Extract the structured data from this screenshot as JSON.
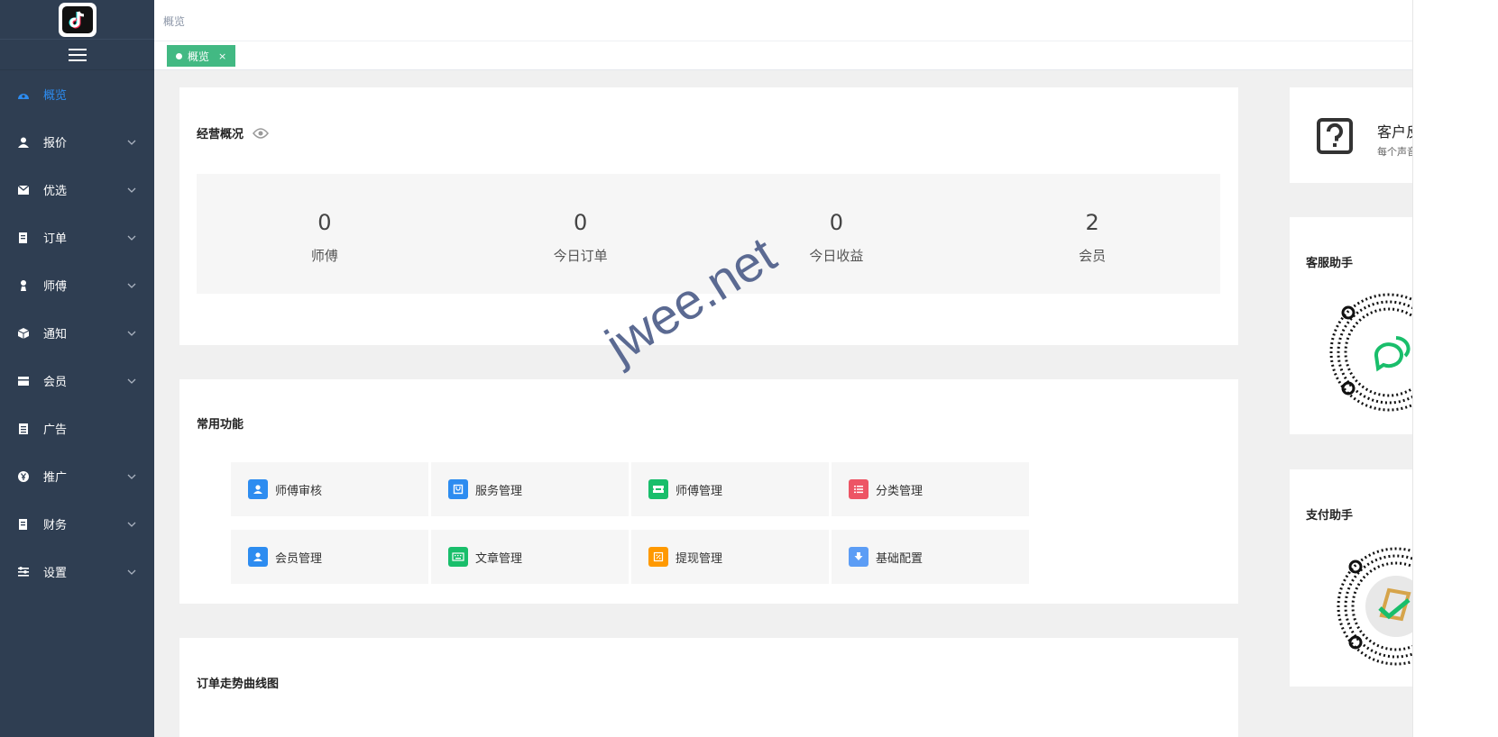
{
  "breadcrumb": "概览",
  "tab": {
    "label": "概览",
    "close": "×"
  },
  "sidebar": {
    "items": [
      {
        "label": "概览",
        "icon": "dashboard-icon",
        "active": true,
        "has_children": false
      },
      {
        "label": "报价",
        "icon": "user-tie-icon",
        "active": false,
        "has_children": true
      },
      {
        "label": "优选",
        "icon": "mail-icon",
        "active": false,
        "has_children": true
      },
      {
        "label": "订单",
        "icon": "document-icon",
        "active": false,
        "has_children": true
      },
      {
        "label": "师傅",
        "icon": "worker-icon",
        "active": false,
        "has_children": true
      },
      {
        "label": "通知",
        "icon": "cube-icon",
        "active": false,
        "has_children": true
      },
      {
        "label": "会员",
        "icon": "card-icon",
        "active": false,
        "has_children": true
      },
      {
        "label": "广告",
        "icon": "calendar-icon",
        "active": false,
        "has_children": false
      },
      {
        "label": "推广",
        "icon": "yen-icon",
        "active": false,
        "has_children": true
      },
      {
        "label": "财务",
        "icon": "finance-icon",
        "active": false,
        "has_children": true
      },
      {
        "label": "设置",
        "icon": "settings-icon",
        "active": false,
        "has_children": true
      }
    ]
  },
  "overview": {
    "title": "经营概况",
    "stats": [
      {
        "value": "0",
        "label": "师傅"
      },
      {
        "value": "0",
        "label": "今日订单"
      },
      {
        "value": "0",
        "label": "今日收益"
      },
      {
        "value": "2",
        "label": "会员"
      }
    ]
  },
  "functions": {
    "title": "常用功能",
    "items": [
      {
        "label": "师傅审核",
        "color": "#2d8cf0",
        "icon": "user-icon"
      },
      {
        "label": "服务管理",
        "color": "#2d8cf0",
        "icon": "bag-icon"
      },
      {
        "label": "师傅管理",
        "color": "#19be6b",
        "icon": "ticket-icon"
      },
      {
        "label": "分类管理",
        "color": "#ed5565",
        "icon": "list-icon"
      },
      {
        "label": "会员管理",
        "color": "#2d8cf0",
        "icon": "user-icon"
      },
      {
        "label": "文章管理",
        "color": "#19be6b",
        "icon": "keyboard-icon"
      },
      {
        "label": "提现管理",
        "color": "#ff9900",
        "icon": "percent-icon"
      },
      {
        "label": "基础配置",
        "color": "#5c9df5",
        "icon": "download-icon"
      }
    ]
  },
  "trend": {
    "title": "订单走势曲线图"
  },
  "feedback": {
    "title": "客户反",
    "subtitle": "每个声音"
  },
  "service_helper": {
    "title": "客服助手"
  },
  "pay_helper": {
    "title": "支付助手"
  },
  "watermark": "jwee.net"
}
